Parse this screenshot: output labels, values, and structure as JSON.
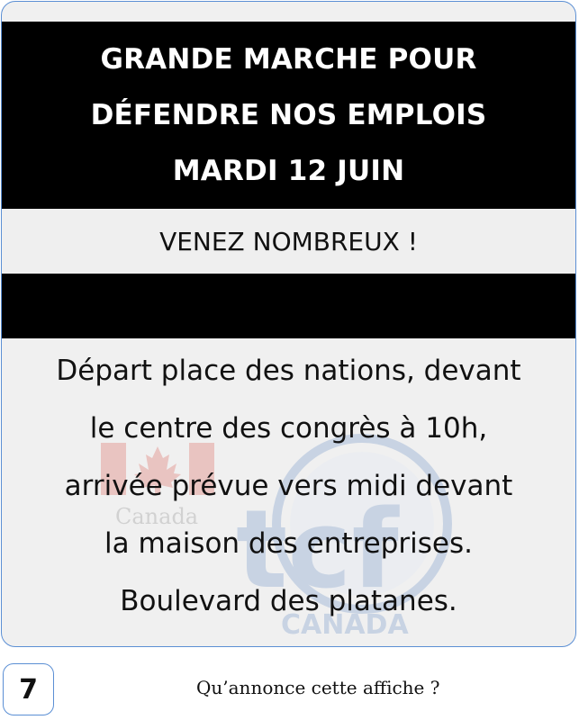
{
  "poster": {
    "title_lines": [
      "GRANDE MARCHE POUR",
      "DÉFENDRE NOS EMPLOIS",
      "MARDI 12 JUIN"
    ],
    "cta": "VENEZ NOMBREUX !",
    "body_lines": [
      "Départ place des nations, devant",
      "le centre des congrès à 10h,",
      "arrivée prévue vers midi devant",
      "la maison des entreprises.",
      "Boulevard des platanes."
    ]
  },
  "watermark": {
    "canada": "Canada",
    "tcf": "tcf",
    "canada_caps": "CANADA",
    "colors": {
      "red": "#d52b1e",
      "blue": "#3d6fb6"
    }
  },
  "footer": {
    "page_number": "7",
    "question": "Qu’annonce cette affiche ?"
  }
}
